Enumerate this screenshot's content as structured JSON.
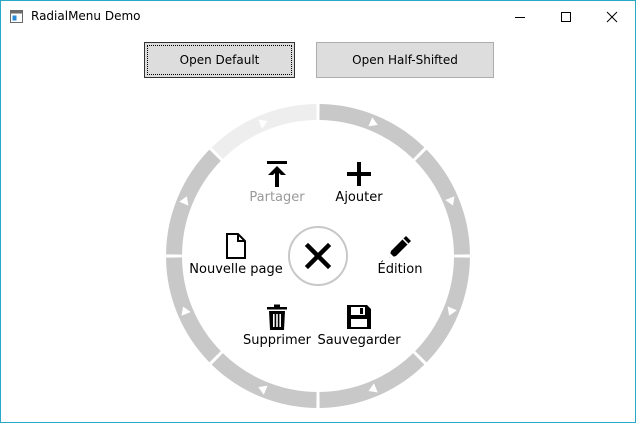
{
  "window": {
    "title": "RadialMenu Demo",
    "icons": {
      "app": "app-icon",
      "minimize": "minimize-icon",
      "maximize": "maximize-icon",
      "close": "close-icon"
    }
  },
  "buttons": {
    "open_default": "Open Default",
    "open_half_shifted": "Open Half-Shifted"
  },
  "radial_menu": {
    "ring_color": "#c8c8c8",
    "disabled_color": "#9a9a9a",
    "items": [
      {
        "label": "Partager",
        "icon": "share-upload-icon",
        "enabled": false
      },
      {
        "label": "Ajouter",
        "icon": "plus-icon",
        "enabled": true
      },
      {
        "label": "Nouvelle page",
        "icon": "new-page-icon",
        "enabled": true
      },
      {
        "label": "Édition",
        "icon": "pencil-icon",
        "enabled": true
      },
      {
        "label": "Supprimer",
        "icon": "trash-icon",
        "enabled": true
      },
      {
        "label": "Sauvegarder",
        "icon": "save-icon",
        "enabled": true
      }
    ],
    "center_icon": "close-icon"
  }
}
